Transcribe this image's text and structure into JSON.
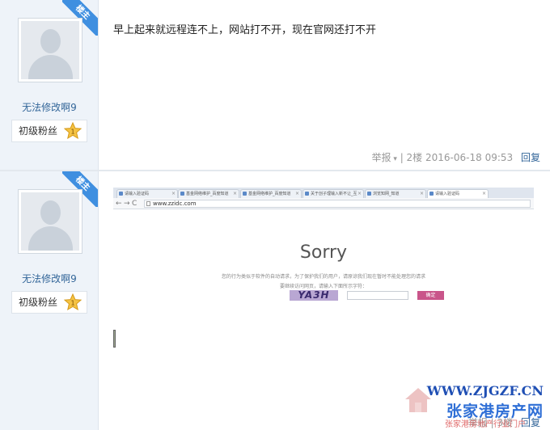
{
  "posts": [
    {
      "badge": "楼主",
      "username": "无法修改啊9",
      "level": "初级粉丝",
      "level_icon": "star-rank-icon",
      "text": "早上起来就远程连不上，网站打不开，现在官网还打不开",
      "meta": {
        "report": "举报",
        "floor": "| 2楼",
        "date": "2016-06-18 09:53",
        "reply": "回复"
      }
    },
    {
      "badge": "楼主",
      "username": "无法修改啊9",
      "level": "初级粉丝",
      "level_icon": "star-rank-icon",
      "meta": {
        "report": "举报",
        "floor": "| 3楼",
        "date": "",
        "reply": "回复"
      }
    }
  ],
  "embedded_browser": {
    "tabs": [
      "请输入验证码",
      "基金网络维护_百度知道",
      "基金网络维护_百度知道",
      "关于创子理输入新不让_互",
      "浏览知网_知道",
      "请输入验证码"
    ],
    "url": "www.zzidc.com",
    "heading": "Sorry",
    "message_line1": "您的行为类似于软件的自动请求，为了保护我们的用户，请原谅我们现在暂时不能处理您的请求",
    "message_line2": "要继续访问网页，请输入下面所示字符：",
    "captcha_text": "YA3H",
    "confirm_button": "确定"
  },
  "watermark": {
    "url": "WWW.ZJGZF.CN",
    "name": "张家港房产网",
    "subtitle": "张家港房地产行业门户"
  },
  "colors": {
    "sidebar_bg": "#eef3f9",
    "badge_blue": "#3f8fe0",
    "link_blue": "#336699",
    "confirm_pink": "#c9558a"
  }
}
